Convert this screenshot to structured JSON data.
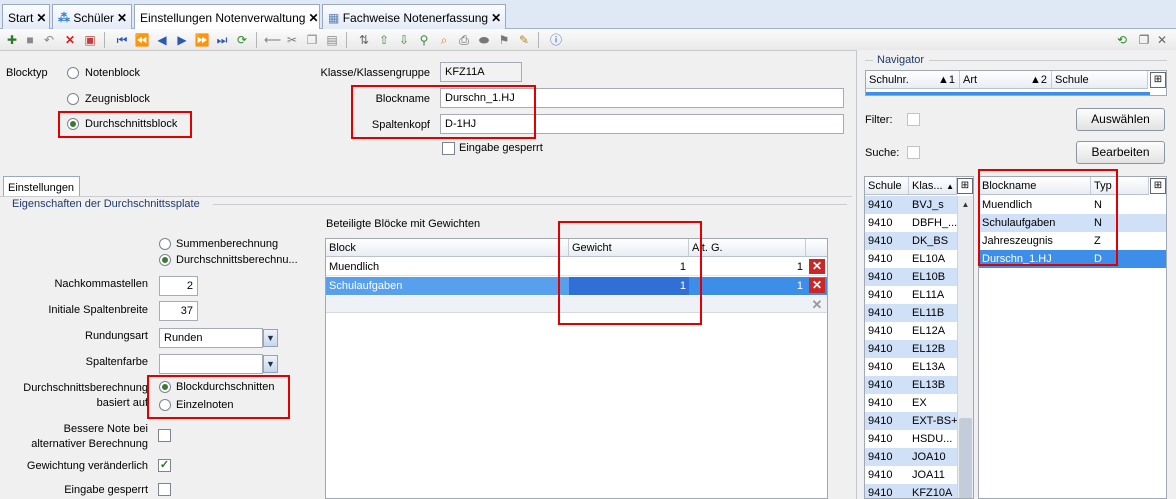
{
  "tabs": [
    {
      "label": "Start",
      "closable": true
    },
    {
      "label": "Schüler",
      "closable": true,
      "icon": "students-icon"
    },
    {
      "label": "Einstellungen Notenverwaltung",
      "closable": true,
      "active": true
    },
    {
      "label": "Fachweise Notenerfassung",
      "closable": true,
      "icon": "grid-icon"
    }
  ],
  "close_glyph": "✕",
  "form": {
    "blocktyp_label": "Blocktyp",
    "blocktyp_options": [
      "Notenblock",
      "Zeugnisblock",
      "Durchschnittsblock"
    ],
    "blocktyp_selected": "Durchschnittsblock",
    "klasse_label": "Klasse/Klassengruppe",
    "klasse_value": "KFZ11A",
    "blockname_label": "Blockname",
    "blockname_value": "Durschn_1.HJ",
    "spaltenkopf_label": "Spaltenkopf",
    "spaltenkopf_value": "D-1HJ",
    "eingabe_gesperrt_label": "Eingabe gesperrt"
  },
  "settings_tab": "Einstellungen",
  "group_title": "Eigenschaften der Durchschnittssplate",
  "calc": {
    "mode_options": [
      "Summenberechnung",
      "Durchschnittsberechnu..."
    ],
    "mode_selected": "Durchschnittsberechnu...",
    "nachkommastellen_label": "Nachkommastellen",
    "nachkommastellen_value": "2",
    "spaltenbreite_label": "Initiale Spaltenbreite",
    "spaltenbreite_value": "37",
    "rundungsart_label": "Rundungsart",
    "rundungsart_value": "Runden",
    "spaltenfarbe_label": "Spaltenfarbe",
    "spaltenfarbe_value": "",
    "basis_label_1": "Durchschnittsberechnung",
    "basis_label_2": "basiert auf",
    "basis_options": [
      "Blockdurchschnitten",
      "Einzelnoten"
    ],
    "basis_selected": "Blockdurchschnitten",
    "bessere_note_1": "Bessere Note bei",
    "bessere_note_2": "alternativer Berechnung",
    "gewichtung_label": "Gewichtung veränderlich",
    "eingabe_label": "Eingabe gesperrt"
  },
  "weights_grid": {
    "title": "Beteiligte Blöcke mit Gewichten",
    "headers": [
      "Block",
      "Gewicht",
      "Alt. G."
    ],
    "rows": [
      {
        "block": "Muendlich",
        "gewicht": "1",
        "alt": "1",
        "selected": false
      },
      {
        "block": "Schulaufgaben",
        "gewicht": "1",
        "alt": "1",
        "selected": true
      }
    ]
  },
  "navigator": {
    "title": "Navigator",
    "headers": [
      "Schulnr.",
      "Art",
      "Schule"
    ],
    "sort_markers": [
      "▲1",
      "▲2"
    ],
    "filter_label": "Filter:",
    "suche_label": "Suche:",
    "auswaehlen_button": "Auswählen",
    "bearbeiten_button": "Bearbeiten",
    "class_headers": [
      "Schule",
      "Klas..."
    ],
    "classes": [
      {
        "schule": "9410",
        "klasse": "BVJ_s"
      },
      {
        "schule": "9410",
        "klasse": "DBFH_..."
      },
      {
        "schule": "9410",
        "klasse": "DK_BS"
      },
      {
        "schule": "9410",
        "klasse": "EL10A"
      },
      {
        "schule": "9410",
        "klasse": "EL10B"
      },
      {
        "schule": "9410",
        "klasse": "EL11A"
      },
      {
        "schule": "9410",
        "klasse": "EL11B"
      },
      {
        "schule": "9410",
        "klasse": "EL12A"
      },
      {
        "schule": "9410",
        "klasse": "EL12B"
      },
      {
        "schule": "9410",
        "klasse": "EL13A"
      },
      {
        "schule": "9410",
        "klasse": "EL13B"
      },
      {
        "schule": "9410",
        "klasse": "EX"
      },
      {
        "schule": "9410",
        "klasse": "EXT-BS+"
      },
      {
        "schule": "9410",
        "klasse": "HSDU..."
      },
      {
        "schule": "9410",
        "klasse": "JOA10"
      },
      {
        "schule": "9410",
        "klasse": "JOA11"
      },
      {
        "schule": "9410",
        "klasse": "KFZ10A"
      }
    ],
    "block_headers": [
      "Blockname",
      "Typ"
    ],
    "blocks": [
      {
        "name": "Muendlich",
        "typ": "N",
        "selected": false
      },
      {
        "name": "Schulaufgaben",
        "typ": "N",
        "selected": false
      },
      {
        "name": "Jahreszeugnis",
        "typ": "Z",
        "selected": false
      },
      {
        "name": "Durschn_1.HJ",
        "typ": "D",
        "selected": true
      }
    ]
  },
  "colors": {
    "selection": "#3d8ee8",
    "highlight": "#cfe0f7",
    "annotation": "#e00000"
  }
}
